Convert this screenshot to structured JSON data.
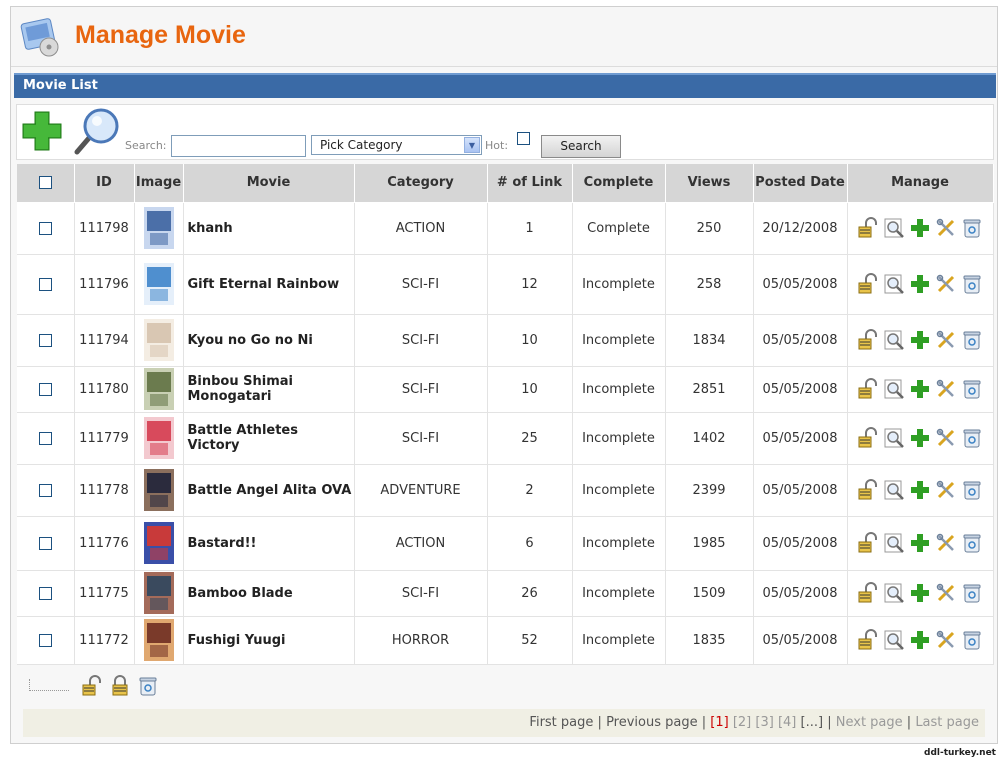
{
  "header": {
    "title": "Manage Movie"
  },
  "section": {
    "title": "Movie List"
  },
  "toolbar": {
    "search_label": "Search:",
    "search_value": "",
    "category_selected": "Pick Category",
    "hot_label": "Hot:",
    "search_button": "Search"
  },
  "table": {
    "headers": {
      "id": "ID",
      "image": "Image",
      "movie": "Movie",
      "category": "Category",
      "links": "# of Link",
      "complete": "Complete",
      "views": "Views",
      "posted": "Posted Date",
      "manage": "Manage"
    },
    "rows": [
      {
        "id": "111798",
        "movie": "khanh",
        "category": "ACTION",
        "links": "1",
        "complete": "Complete",
        "views": "250",
        "posted": "20/12/2008"
      },
      {
        "id": "111796",
        "movie": "Gift Eternal Rainbow",
        "category": "SCI-FI",
        "links": "12",
        "complete": "Incomplete",
        "views": "258",
        "posted": "05/05/2008"
      },
      {
        "id": "111794",
        "movie": "Kyou no Go no Ni",
        "category": "SCI-FI",
        "links": "10",
        "complete": "Incomplete",
        "views": "1834",
        "posted": "05/05/2008"
      },
      {
        "id": "111780",
        "movie": "Binbou Shimai Monogatari",
        "category": "SCI-FI",
        "links": "10",
        "complete": "Incomplete",
        "views": "2851",
        "posted": "05/05/2008"
      },
      {
        "id": "111779",
        "movie": "Battle Athletes Victory",
        "category": "SCI-FI",
        "links": "25",
        "complete": "Incomplete",
        "views": "1402",
        "posted": "05/05/2008"
      },
      {
        "id": "111778",
        "movie": "Battle Angel Alita OVA",
        "category": "ADVENTURE",
        "links": "2",
        "complete": "Incomplete",
        "views": "2399",
        "posted": "05/05/2008"
      },
      {
        "id": "111776",
        "movie": "Bastard!!",
        "category": "ACTION",
        "links": "6",
        "complete": "Incomplete",
        "views": "1985",
        "posted": "05/05/2008"
      },
      {
        "id": "111775",
        "movie": "Bamboo Blade",
        "category": "SCI-FI",
        "links": "26",
        "complete": "Incomplete",
        "views": "1509",
        "posted": "05/05/2008"
      },
      {
        "id": "111772",
        "movie": "Fushigi Yuugi",
        "category": "HORROR",
        "links": "52",
        "complete": "Incomplete",
        "views": "1835",
        "posted": "05/05/2008"
      }
    ]
  },
  "pager": {
    "first": "First page",
    "sep": "|",
    "previous": "Previous page",
    "pages": [
      "[1]",
      "[2]",
      "[3]",
      "[4]",
      "[...]"
    ],
    "next": "Next page",
    "last": "Last page"
  },
  "watermark": "ddl-turkey.net",
  "icons": {
    "row_actions": [
      "unlock-icon",
      "view-icon",
      "add-icon",
      "edit-icon",
      "trash-icon"
    ],
    "bottom_actions": [
      "unlock-icon",
      "lock-icon",
      "trash-icon"
    ],
    "toolbar": [
      "add-big-icon",
      "search-big-icon"
    ]
  },
  "colors": {
    "title": "#e8650f",
    "section_bar": "#3a6aa6",
    "header_row": "#d6d6d6",
    "current_page": "#cc0000"
  }
}
